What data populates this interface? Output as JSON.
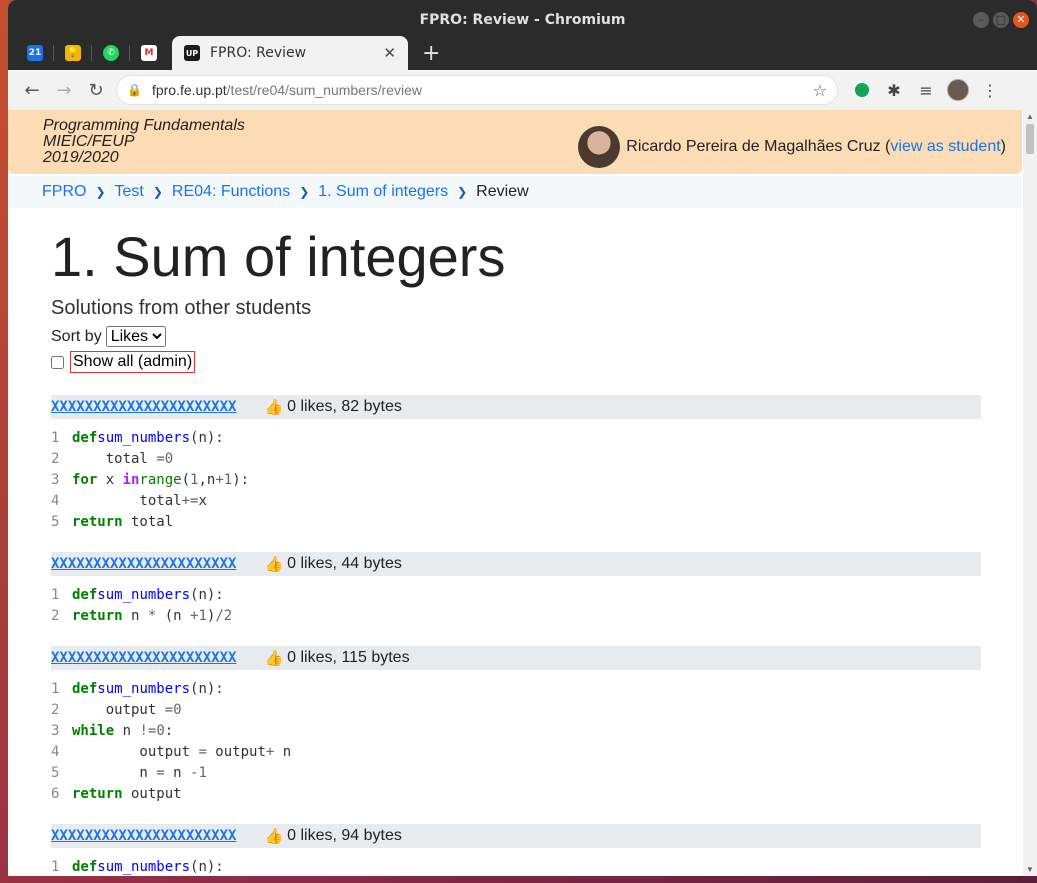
{
  "window": {
    "title": "FPRO: Review - Chromium"
  },
  "tabs": {
    "pinned": [
      {
        "name": "calendar",
        "text": "21",
        "color": "#1a73e8"
      },
      {
        "name": "keep",
        "text": "",
        "color": "#f4b400"
      },
      {
        "name": "whatsapp",
        "text": "",
        "color": "#25d366"
      },
      {
        "name": "gmail",
        "text": "M",
        "color": "#ffffff"
      }
    ],
    "active": {
      "label": "FPRO: Review",
      "favicon_text": "UP"
    }
  },
  "toolbar": {
    "url_host": "fpro.fe.up.pt",
    "url_path": "/test/re04/sum_numbers/review"
  },
  "header": {
    "course_lines": [
      "Programming Fundamentals",
      "MIEIC/FEUP",
      "2019/2020"
    ],
    "user_name": "Ricardo Pereira de Magalhães Cruz",
    "view_link": "view as student"
  },
  "breadcrumb": {
    "items": [
      "FPRO",
      "Test",
      "RE04: Functions",
      "1. Sum of integers"
    ],
    "current": "Review"
  },
  "main": {
    "title": "1. Sum of integers",
    "subtitle": "Solutions from other students",
    "sort_label": "Sort by",
    "sort_selected": "Likes",
    "show_all_label": "Show all (admin)"
  },
  "solutions": [
    {
      "author": "XXXXXXXXXXXXXXXXXXXXXX",
      "stats": "0 likes, 82 bytes"
    },
    {
      "author": "XXXXXXXXXXXXXXXXXXXXXX",
      "stats": "0 likes, 44 bytes"
    },
    {
      "author": "XXXXXXXXXXXXXXXXXXXXXX",
      "stats": "0 likes, 115 bytes"
    },
    {
      "author": "XXXXXXXXXXXXXXXXXXXXXX",
      "stats": "0 likes, 94 bytes"
    }
  ]
}
